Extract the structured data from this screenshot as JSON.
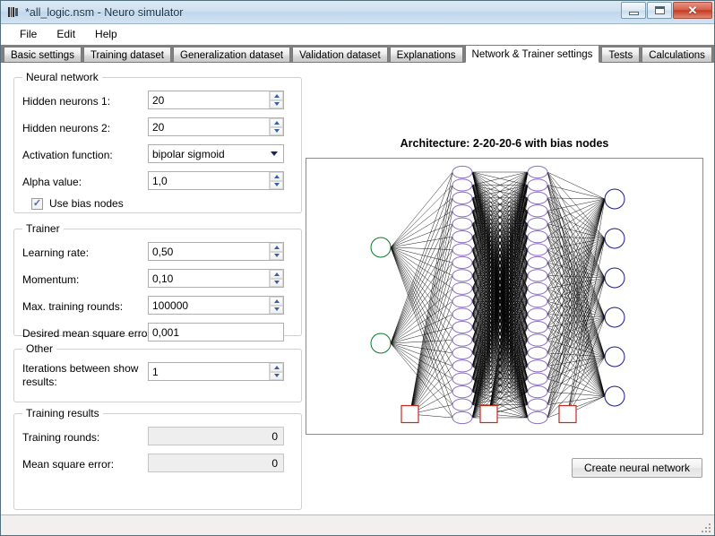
{
  "window": {
    "title": "*all_logic.nsm - Neuro simulator",
    "icon": "app-bars-icon",
    "minimize_label": "–",
    "maximize_label": "❐",
    "close_label": "✕"
  },
  "menu": {
    "items": [
      {
        "label": "File"
      },
      {
        "label": "Edit"
      },
      {
        "label": "Help"
      }
    ]
  },
  "tabs": [
    {
      "label": "Basic settings",
      "active": false
    },
    {
      "label": "Training dataset",
      "active": false
    },
    {
      "label": "Generalization dataset",
      "active": false
    },
    {
      "label": "Validation dataset",
      "active": false
    },
    {
      "label": "Explanations",
      "active": false
    },
    {
      "label": "Network & Trainer settings",
      "active": true
    },
    {
      "label": "Tests",
      "active": false
    },
    {
      "label": "Calculations",
      "active": false
    }
  ],
  "neural_network": {
    "caption": "Neural network",
    "hidden1": {
      "label": "Hidden neurons 1:",
      "value": "20"
    },
    "hidden2": {
      "label": "Hidden neurons 2:",
      "value": "20"
    },
    "activation": {
      "label": "Activation function:",
      "value": "bipolar sigmoid",
      "options": [
        "bipolar sigmoid"
      ]
    },
    "alpha": {
      "label": "Alpha value:",
      "value": "1,0"
    },
    "bias": {
      "label": "Use bias nodes",
      "checked": true,
      "mark": "✓"
    }
  },
  "trainer": {
    "caption": "Trainer",
    "learning_rate": {
      "label": "Learning rate:",
      "value": "0,50"
    },
    "momentum": {
      "label": "Momentum:",
      "value": "0,10"
    },
    "max_rounds": {
      "label": "Max. training rounds:",
      "value": "100000"
    },
    "mse": {
      "label": "Desired mean square error:",
      "value": "0,001"
    }
  },
  "other": {
    "caption": "Other",
    "iterations": {
      "label": "Iterations between show results:",
      "value": "1"
    }
  },
  "training_results": {
    "caption": "Training results",
    "rounds": {
      "label": "Training rounds:",
      "value": "0"
    },
    "mse": {
      "label": "Mean square error:",
      "value": "0"
    }
  },
  "architecture": {
    "title": "Architecture: 2-20-20-6 with bias nodes",
    "create_button": "Create neural network"
  },
  "network_diagram": {
    "layers": [
      {
        "name": "input",
        "count": 2,
        "shape": "circle",
        "color": "#0a7a2a"
      },
      {
        "name": "hidden1",
        "count": 20,
        "shape": "ellipse",
        "color": "#8d6fc4"
      },
      {
        "name": "hidden2",
        "count": 20,
        "shape": "ellipse",
        "color": "#8d6fc4"
      },
      {
        "name": "output",
        "count": 6,
        "shape": "circle",
        "color": "#1a1a8c"
      }
    ],
    "bias_nodes": {
      "count": 3,
      "shape": "square",
      "color": "#c02b1e"
    },
    "edge_color": "#000000"
  }
}
